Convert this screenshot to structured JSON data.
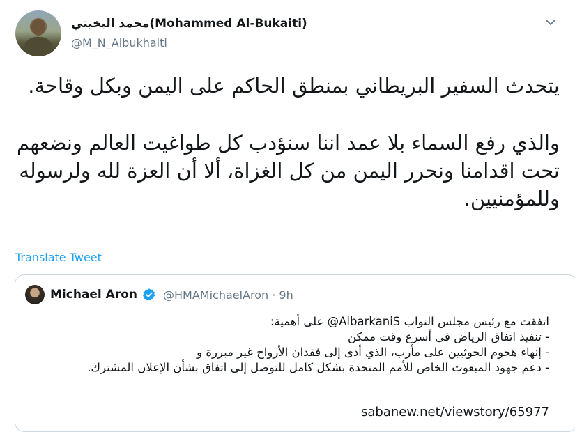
{
  "author": {
    "display_name": "محمد البخيتي(Mohammed Al-Bukaiti)",
    "handle": "@M_N_Albukhaiti"
  },
  "tweet": {
    "paragraph_1": "يتحدث السفير البريطاني بمنطق الحاكم على اليمن وبكل وقاحة.",
    "paragraph_2": "والذي رفع السماء بلا عمد اننا سنؤدب كل طواغيت العالم ونضعهم تحت اقدامنا ونحرر اليمن من كل الغزاة، ألا أن العزة لله ولرسوله وللمؤمنيين."
  },
  "translate_label": "Translate Tweet",
  "quoted": {
    "name": "Michael Aron",
    "handle_time": "@HMAMichaelAron · 9h",
    "lines": [
      "اتفقت مع رئيس مجلس النواب AlbarkaniS@ على أهمية:",
      "- تنفيذ اتفاق الرياض في أسرع وقت ممكن",
      "- إنهاء هجوم الحوثيين على مأرب، الذي أدى إلى فقدان الأرواح غير مبررة و",
      "- دعم جهود المبعوث الخاص للأمم المتحدة بشكل كامل للتوصل إلى اتفاق بشأن الإعلان المشترك."
    ],
    "link": "sabanew.net/viewstory/65977"
  },
  "icons": {
    "chevron": "chevron-down-icon",
    "verified": "verified-badge-icon"
  },
  "colors": {
    "link_blue": "#1da1f2",
    "secondary_text": "#657786",
    "border": "#ccd6dd"
  }
}
